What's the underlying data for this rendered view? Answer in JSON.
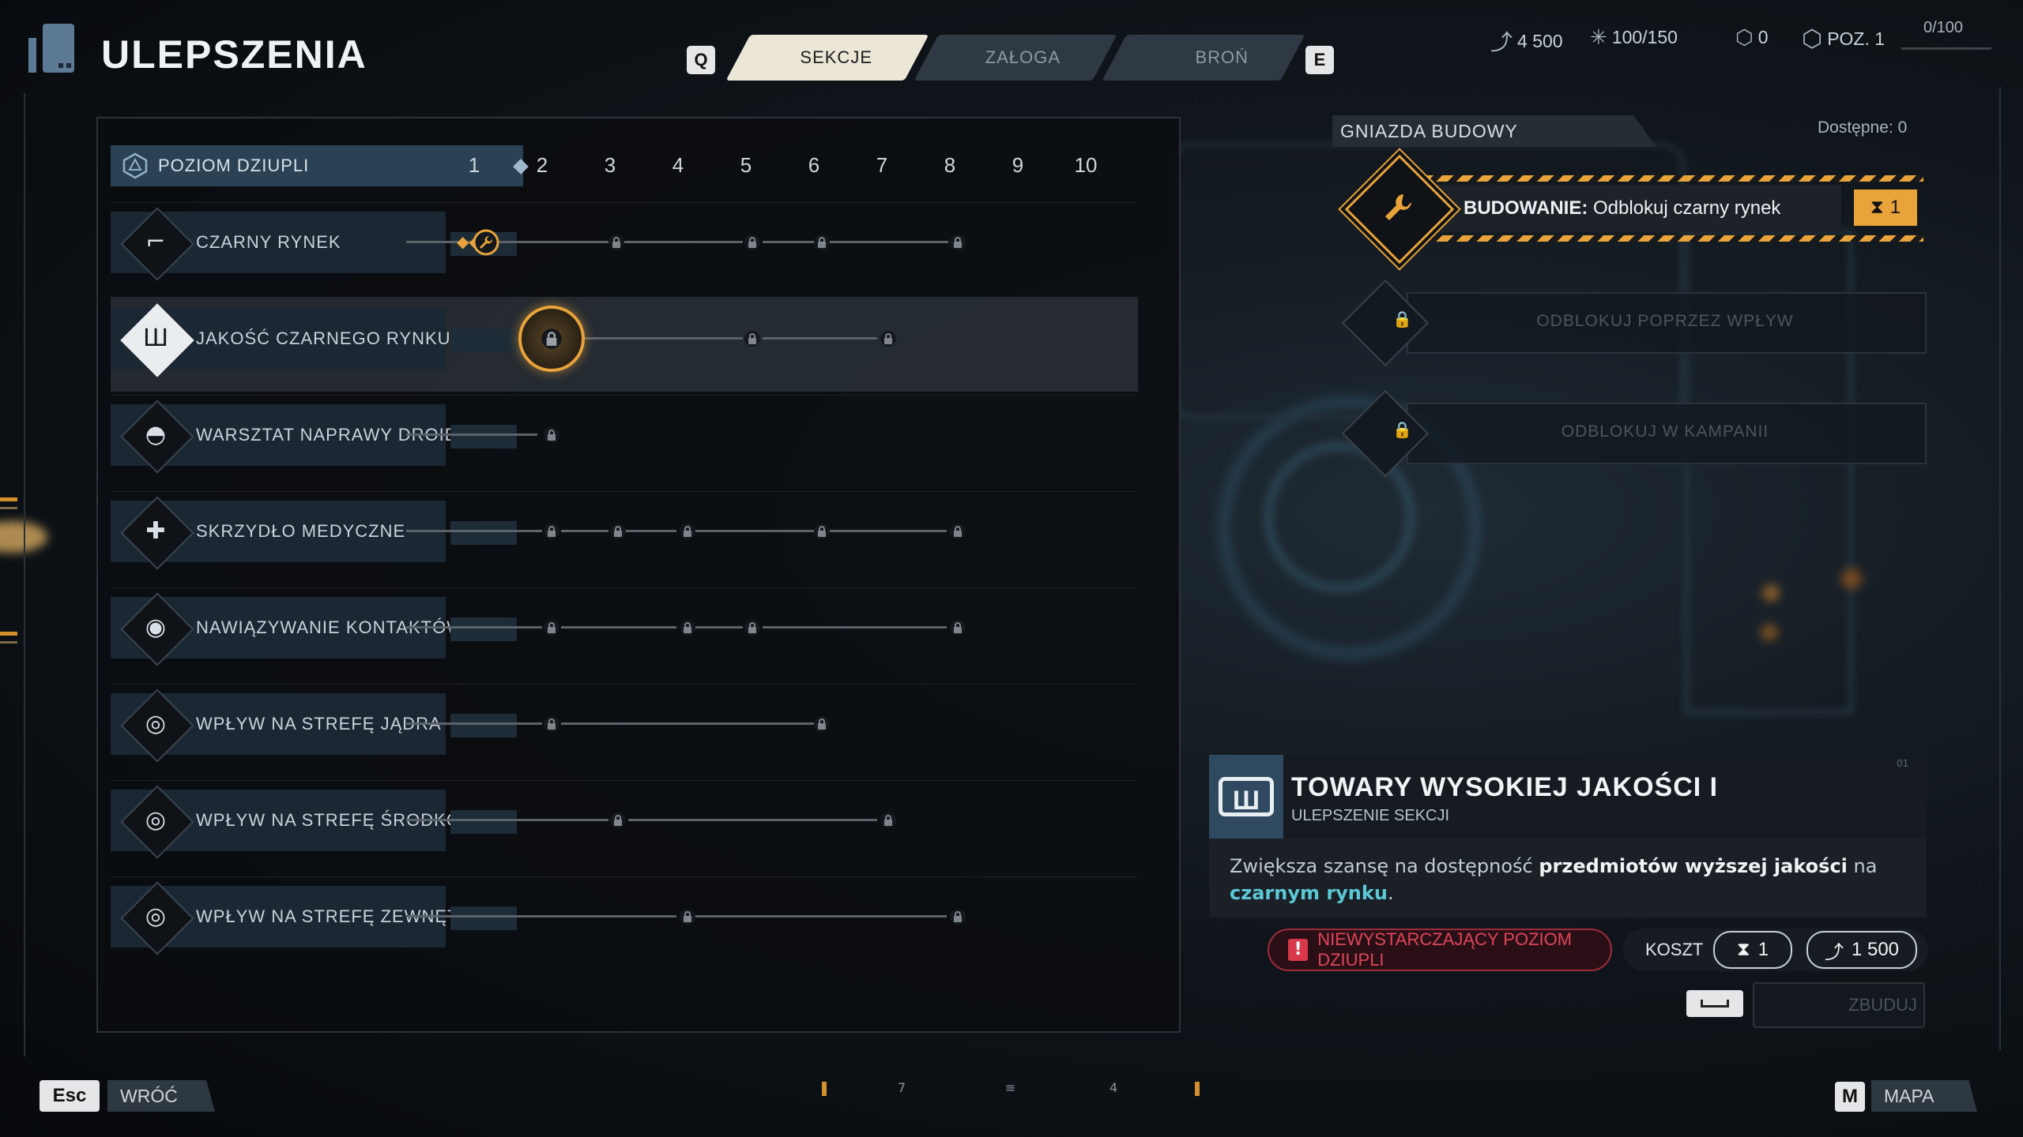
{
  "header": {
    "title": "ULEPSZENIA",
    "tabs": [
      {
        "key": "Q"
      },
      {
        "label": "SEKCJE",
        "active": true
      },
      {
        "label": "ZAŁOGA",
        "active": false
      },
      {
        "label": "BROŃ",
        "active": false
      },
      {
        "key": "E"
      }
    ],
    "key_left": "Q",
    "key_right": "E",
    "resources": {
      "credits": "4 500",
      "supply": "100/150",
      "tokens": "0",
      "level": "POZ. 1",
      "xp": "0/100",
      "xp_progress": 0
    }
  },
  "levels": {
    "label": "POZIOM DZIUPLI",
    "numbers": [
      "1",
      "2",
      "3",
      "4",
      "5",
      "6",
      "7",
      "8",
      "9",
      "10"
    ],
    "current": 1
  },
  "sections": [
    {
      "label": "CZARNY RYNEK",
      "icon": "blaster-icon"
    },
    {
      "label": "JAKOŚĆ CZARNEGO RYNKU",
      "icon": "crate-icon",
      "selected": true
    },
    {
      "label": "WARSZTAT NAPRAWY DROIDÓW",
      "icon": "droid-icon"
    },
    {
      "label": "SKRZYDŁO MEDYCZNE",
      "icon": "medical-cross-icon"
    },
    {
      "label": "NAWIĄZYWANIE KONTAKTÓW",
      "icon": "signal-icon"
    },
    {
      "label": "WPŁYW NA STREFĘ JĄDRA",
      "icon": "influence-icon"
    },
    {
      "label": "WPŁYW NA STREFĘ ŚRODKOWĄ",
      "icon": "influence-icon"
    },
    {
      "label": "WPŁYW NA STREFĘ ZEWNĘTRZNĄ",
      "icon": "influence-icon"
    }
  ],
  "build_slots": {
    "title": "GNIAZDA BUDOWY",
    "available": "Dostępne: 0",
    "active": {
      "prefix": "BUDOWANIE:",
      "text": "Odblokuj czarny rynek",
      "timer": "1"
    },
    "locked": [
      "ODBLOKUJ POPRZEZ WPŁYW",
      "ODBLOKUJ W KAMPANII"
    ]
  },
  "info": {
    "title": "TOWARY WYSOKIEJ JAKOŚCI I",
    "subtitle": "ULEPSZENIE SEKCJI",
    "desc_1": "Zwiększa szansę na dostępność",
    "desc_bold": "przedmiotów wyższej jakości",
    "desc_2": "na",
    "desc_link": "czarnym rynku",
    "desc_end": ".",
    "tag": "01",
    "warning": "NIEWYSTARCZAJĄCY POZIOM DZIUPLI",
    "cost_label": "KOSZT",
    "cost_time": "1",
    "cost_credits": "1 500",
    "build_button": "ZBUDUJ"
  },
  "footer": {
    "back_key": "Esc",
    "back_label": "WRÓĆ",
    "map_key": "M",
    "map_label": "MAPA",
    "page_marks": [
      "7",
      "≡",
      "4"
    ]
  },
  "colors": {
    "accent": "#e8a33a",
    "warning": "#d8384a",
    "link": "#5cc7d6",
    "tab_active": "#ece6d6"
  }
}
